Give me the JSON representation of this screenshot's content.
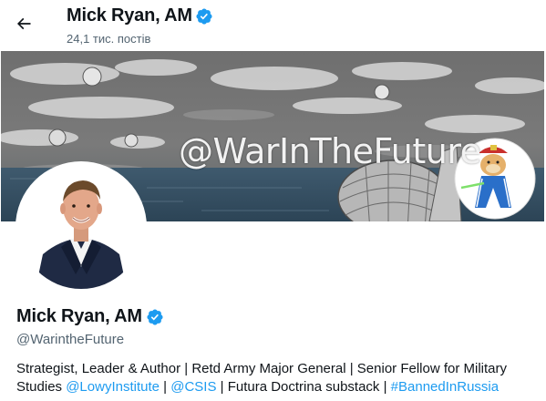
{
  "header": {
    "name": "Mick Ryan, AM",
    "posts_count": "24,1 тис. постів"
  },
  "banner": {
    "handle_text": "@WarInTheFuture"
  },
  "profile": {
    "name": "Mick Ryan, AM",
    "handle": "@WarintheFuture"
  },
  "bio": {
    "part1": "Strategist, Leader & Author | Retd Army Major General | Senior Fellow for Military Studies ",
    "link1": "@LowyInstitute",
    "sep1": " | ",
    "link2": "@CSIS",
    "part2": " | Futura Doctrina substack | ",
    "link3": "#BannedInRussia"
  },
  "colors": {
    "verified": "#1d9bf0",
    "link": "#1d9bf0",
    "secondary_text": "#536471"
  },
  "icons": {
    "back": "arrow-left-icon",
    "verified": "verified-badge-icon"
  }
}
